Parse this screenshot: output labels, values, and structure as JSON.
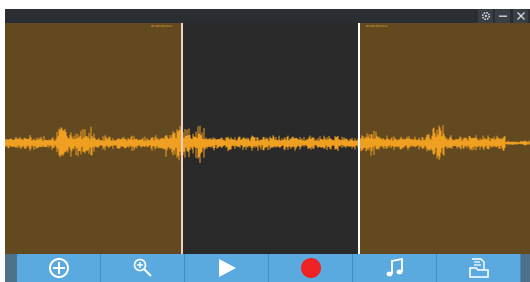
{
  "window": {
    "controls": [
      "gear-icon",
      "minimize-icon",
      "close-icon"
    ]
  },
  "waveform": {
    "color": "#f0a020",
    "selected_region_color": "#62491f",
    "unselected_region_color": "#2a2a2a",
    "regions": [
      {
        "name": "left-region",
        "label": "0h:00m00s:0ms"
      },
      {
        "name": "middle-region"
      },
      {
        "name": "right-region",
        "label": "0h:00m00s:0ms"
      }
    ]
  },
  "toolbar": {
    "background": "#5aaae0",
    "buttons": [
      {
        "name": "add-button",
        "icon": "plus-circle-icon"
      },
      {
        "name": "zoom-button",
        "icon": "zoom-in-icon"
      },
      {
        "name": "play-button",
        "icon": "play-icon"
      },
      {
        "name": "record-button",
        "icon": "record-icon",
        "color": "#ee2222"
      },
      {
        "name": "music-button",
        "icon": "music-note-icon"
      },
      {
        "name": "open-file-button",
        "icon": "folder-icon"
      }
    ]
  }
}
